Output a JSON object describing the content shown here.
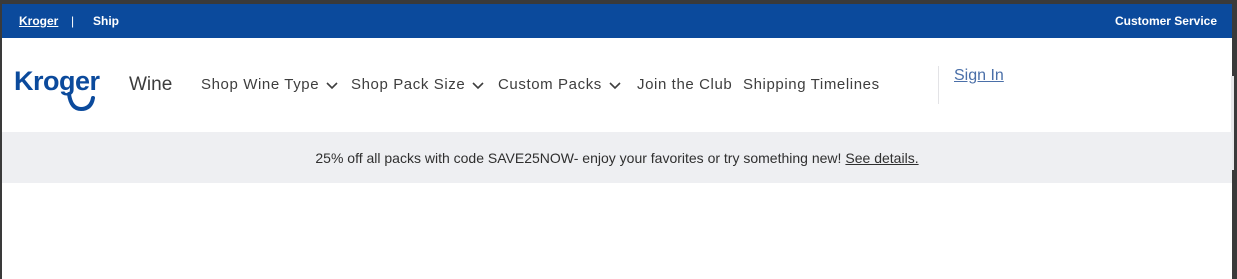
{
  "utility_bar": {
    "home_link": "Kroger",
    "separator": "|",
    "ship_link": "Ship",
    "customer_service": "Customer Service",
    "background_color": "#0b4a9c"
  },
  "header": {
    "logo_text": "Kroger",
    "logo_icon": "kroger-logo-icon",
    "site_title": "Wine",
    "nav": [
      {
        "label": "Shop Wine Type",
        "has_dropdown": true
      },
      {
        "label": "Shop Pack Size",
        "has_dropdown": true
      },
      {
        "label": "Custom Packs",
        "has_dropdown": true
      },
      {
        "label": "Join the Club",
        "has_dropdown": false
      },
      {
        "label": "Shipping Timelines",
        "has_dropdown": false
      }
    ],
    "sign_in": "Sign In",
    "brand_color": "#0b4a9c"
  },
  "promo": {
    "text": "25% off all packs with code SAVE25NOW- enjoy your favorites or try something new!",
    "link": "See details."
  }
}
